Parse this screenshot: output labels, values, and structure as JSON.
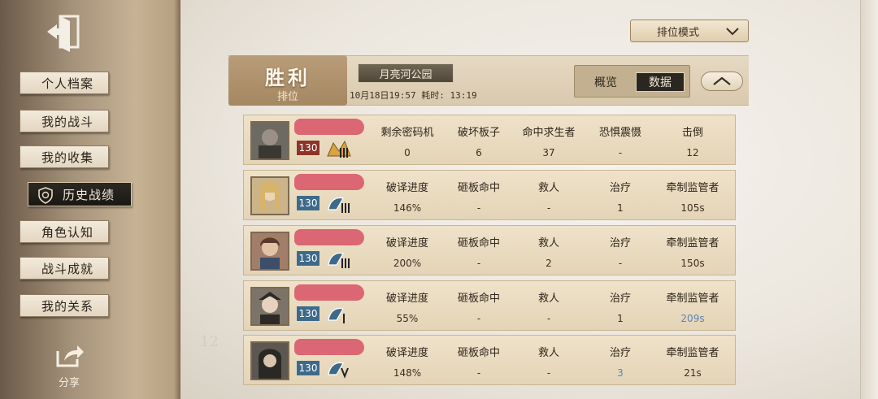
{
  "sidebar": {
    "items": [
      {
        "label": "个人档案",
        "active": false
      },
      {
        "label": "我的战斗",
        "active": false
      },
      {
        "label": "我的收集",
        "active": false
      },
      {
        "label": "历史战绩",
        "active": true
      },
      {
        "label": "角色认知",
        "active": false
      },
      {
        "label": "战斗成就",
        "active": false
      },
      {
        "label": "我的关系",
        "active": false
      }
    ],
    "share_label": "分享"
  },
  "header": {
    "mode_dropdown": "排位模式",
    "result": "胜利",
    "match_type": "排位",
    "map_name": "月亮河公园",
    "match_info": "10月18日19:57  耗时: 13:19",
    "tabs": {
      "overview": "概览",
      "data": "数据"
    }
  },
  "hunter_row": {
    "level": "130",
    "columns": [
      {
        "header": "剩余密码机",
        "value": "0"
      },
      {
        "header": "破坏板子",
        "value": "6"
      },
      {
        "header": "命中求生者",
        "value": "37"
      },
      {
        "header": "恐惧震慑",
        "value": "-"
      },
      {
        "header": "击倒",
        "value": "12"
      }
    ]
  },
  "survivor_rows": [
    {
      "level": "130",
      "columns": [
        {
          "header": "破译进度",
          "value": "146%"
        },
        {
          "header": "砸板命中",
          "value": "-"
        },
        {
          "header": "救人",
          "value": "-"
        },
        {
          "header": "治疗",
          "value": "1"
        },
        {
          "header": "牵制监管者",
          "value": "105s"
        }
      ]
    },
    {
      "level": "130",
      "columns": [
        {
          "header": "破译进度",
          "value": "200%"
        },
        {
          "header": "砸板命中",
          "value": "-"
        },
        {
          "header": "救人",
          "value": "2"
        },
        {
          "header": "治疗",
          "value": "-"
        },
        {
          "header": "牵制监管者",
          "value": "150s"
        }
      ]
    },
    {
      "level": "130",
      "columns": [
        {
          "header": "破译进度",
          "value": "55%"
        },
        {
          "header": "砸板命中",
          "value": "-"
        },
        {
          "header": "救人",
          "value": "-"
        },
        {
          "header": "治疗",
          "value": "1"
        },
        {
          "header": "牵制监管者",
          "value": "209s"
        }
      ]
    },
    {
      "level": "130",
      "columns": [
        {
          "header": "破译进度",
          "value": "148%"
        },
        {
          "header": "砸板命中",
          "value": "-"
        },
        {
          "header": "救人",
          "value": "-"
        },
        {
          "header": "治疗",
          "value": "3"
        },
        {
          "header": "牵制监管者",
          "value": "21s"
        }
      ]
    }
  ],
  "background_number": "12",
  "colors": {
    "accent_dark": "#2a2620",
    "hunter_level_bg": "#8e3328",
    "survivor_level_bg": "#3e6a8a",
    "highlight_value": "#5a86b4",
    "redaction": "#d95c6d"
  }
}
